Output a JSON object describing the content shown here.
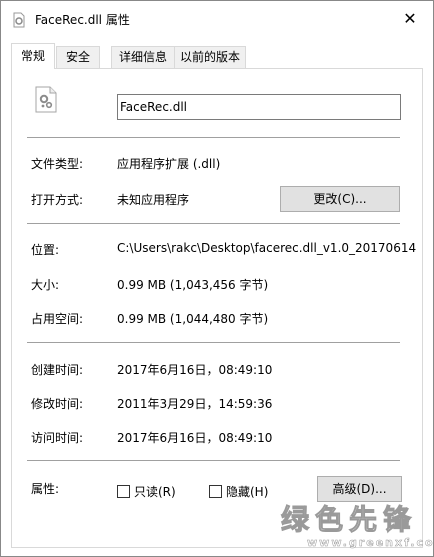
{
  "window": {
    "title": "FaceRec.dll 属性",
    "close_glyph": "✕"
  },
  "tabs": [
    {
      "label": "常规",
      "active": true
    },
    {
      "label": "安全",
      "active": false
    },
    {
      "label": "详细信息",
      "active": false
    },
    {
      "label": "以前的版本",
      "active": false
    }
  ],
  "general": {
    "file_name": "FaceRec.dll",
    "file_icon": "dll-gear-file-icon",
    "type_label": "文件类型:",
    "type_value": "应用程序扩展 (.dll)",
    "opens_label": "打开方式:",
    "opens_value": "未知应用程序",
    "change_button": "更改(C)...",
    "location_label": "位置:",
    "location_value": "C:\\Users\\rakc\\Desktop\\facerec.dll_v1.0_20170614",
    "size_label": "大小:",
    "size_value": "0.99 MB (1,043,456 字节)",
    "disk_size_label": "占用空间:",
    "disk_size_value": "0.99 MB (1,044,480 字节)",
    "created_label": "创建时间:",
    "created_value": "2017年6月16日，08:49:10",
    "modified_label": "修改时间:",
    "modified_value": "2011年3月29日，14:59:36",
    "accessed_label": "访问时间:",
    "accessed_value": "2017年6月16日，08:49:10",
    "attributes_label": "属性:",
    "readonly_label": "只读(R)",
    "readonly_checked": false,
    "hidden_label": "隐藏(H)",
    "hidden_checked": false,
    "advanced_button": "高级(D)..."
  },
  "watermark": {
    "text": "绿色先锋",
    "url": "www.greenxf.com"
  }
}
